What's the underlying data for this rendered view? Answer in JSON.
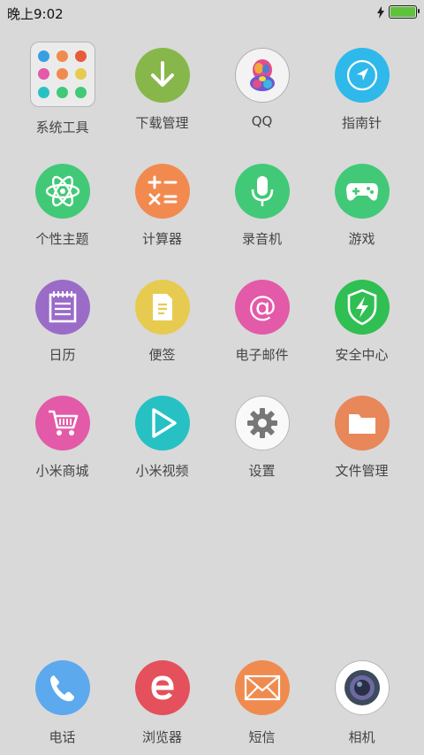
{
  "status": {
    "time": "晚上9:02",
    "battery_level": 1.0,
    "charging": true
  },
  "apps": [
    {
      "label": "系统工具",
      "icon": "folder-icon"
    },
    {
      "label": "下载管理",
      "icon": "download-icon",
      "color": "#87b74b"
    },
    {
      "label": "QQ",
      "icon": "qq-icon",
      "color": "#f3f3f3"
    },
    {
      "label": "指南针",
      "icon": "compass-icon",
      "color": "#2fb9ea"
    },
    {
      "label": "个性主题",
      "icon": "theme-icon",
      "color": "#41c977"
    },
    {
      "label": "计算器",
      "icon": "calculator-icon",
      "color": "#f28a4f"
    },
    {
      "label": "录音机",
      "icon": "microphone-icon",
      "color": "#41c977"
    },
    {
      "label": "游戏",
      "icon": "gamepad-icon",
      "color": "#41c977"
    },
    {
      "label": "日历",
      "icon": "calendar-icon",
      "color": "#9a6cc8"
    },
    {
      "label": "便签",
      "icon": "note-icon",
      "color": "#e7cb50"
    },
    {
      "label": "电子邮件",
      "icon": "email-icon",
      "color": "#e35aa8"
    },
    {
      "label": "安全中心",
      "icon": "shield-icon",
      "color": "#2fbf52"
    },
    {
      "label": "小米商城",
      "icon": "cart-icon",
      "color": "#e35aa8"
    },
    {
      "label": "小米视频",
      "icon": "play-icon",
      "color": "#27c1c4"
    },
    {
      "label": "设置",
      "icon": "settings-gear-icon",
      "color": "#f9f9f9"
    },
    {
      "label": "文件管理",
      "icon": "folder-file-icon",
      "color": "#e8875a"
    }
  ],
  "dock": [
    {
      "label": "电话",
      "icon": "phone-icon",
      "color": "#5ca9ee"
    },
    {
      "label": "浏览器",
      "icon": "browser-icon",
      "color": "#e4505b"
    },
    {
      "label": "短信",
      "icon": "sms-icon",
      "color": "#f08b4f"
    },
    {
      "label": "相机",
      "icon": "camera-icon",
      "color": "#ffffff"
    }
  ]
}
